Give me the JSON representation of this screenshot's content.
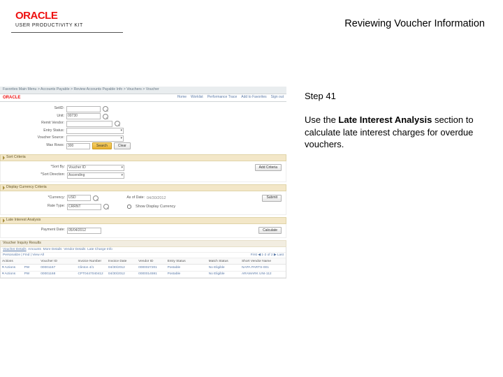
{
  "header": {
    "brand": "ORACLE",
    "product": "USER PRODUCTIVITY KIT",
    "title": "Reviewing Voucher Information"
  },
  "step": {
    "label": "Step 41",
    "text_before": "Use the ",
    "bold": "Late Interest Analysis",
    "text_after": " section to calculate late interest charges for overdue vouchers."
  },
  "app": {
    "breadcrumbs": "Favorites    Main Menu  >  Accounts Payable  >  Review Accounts Payable Info  >  Vouchers  >  Voucher",
    "oracle": "ORACLE",
    "tabs": [
      "Home",
      "Worklist",
      "Performance Trace",
      "Add to Favorites",
      "Sign out"
    ],
    "form": {
      "labels": {
        "setid": "SetID:",
        "unit": "Unit:",
        "remit": "Remit Vendor:",
        "status": "Entry Status:",
        "src": "Voucher Source:",
        "max": "Max Rows:"
      },
      "unit_val": "00730",
      "status_val": "",
      "src_val": "",
      "max_val": "300",
      "search": "Search",
      "clear": "Clear"
    },
    "sort": {
      "title": "Sort Criteria",
      "sortby_lbl": "*Sort By:",
      "sortby": "Voucher ID",
      "sortdir_lbl": "*Sort Direction:",
      "sortdir": "Ascending",
      "add": "Add Criteria"
    },
    "disp": {
      "title": "Display Currency Criteria",
      "cur_lbl": "*Currency:",
      "cur": "USD",
      "asof_lbl": "As of Date:",
      "asof": "04/30/2012",
      "rate_lbl": "Rate Type:",
      "rate": "CRRNT",
      "show": "Show Display Currency",
      "submit": "Submit"
    },
    "late": {
      "title": "Late Interest Analysis",
      "pay_lbl": "Payment Date:",
      "pay": "05/04/2012",
      "calc": "Calculate"
    },
    "results": {
      "title": "Voucher Inquiry Results",
      "pager_left": "Personalize | Find | View All",
      "pager_right": "First ◀ 1-2 of 2 ▶ Last",
      "tab_labels": [
        "Voucher Details",
        "Amounts",
        "More Details",
        "Vendor Details",
        "Late Charge Info"
      ],
      "cols": [
        "Actions",
        "",
        "Voucher ID",
        "Invoice Number",
        "Invoice Date",
        "Vendor ID",
        "Entry Status",
        "Match Status",
        "Short Vendor Name"
      ],
      "rows": [
        [
          "▾ Actions",
          "PW",
          "00001167",
          "Clinton 4/1",
          "04/30/2012",
          "0000027201",
          "Postable",
          "",
          "No Eligible",
          "NAPA PARTS-001"
        ],
        [
          "▾ Actions",
          "PW",
          "00001168",
          "CPT0447040412",
          "04/30/2012",
          "0000014591",
          "Postable",
          "",
          "No Eligible",
          "ARAMARK UNI-112"
        ]
      ]
    }
  }
}
